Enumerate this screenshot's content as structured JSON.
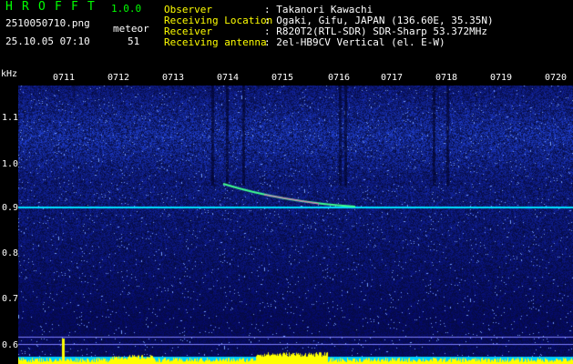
{
  "app": {
    "title_letters": [
      "H",
      "R",
      "O",
      "F",
      "F",
      "T"
    ],
    "version": "1.0.0"
  },
  "file": {
    "name": "2510050710.png",
    "timestamp": "25.10.05 07:10"
  },
  "meteor": {
    "label": "meteor",
    "count": "51"
  },
  "info": {
    "observer_label": "Observer",
    "observer_value": ": Takanori Kawachi",
    "location_label": "Receiving Location",
    "location_value": ": Ogaki, Gifu, JAPAN (136.60E, 35.35N)",
    "receiver_label": "Receiver",
    "receiver_value": ": R820T2(RTL-SDR) SDR-Sharp 53.372MHz",
    "antenna_label": "Receiving antenna",
    "antenna_value": ": 2el-HB9CV Vertical (el. E-W)"
  },
  "axis": {
    "unit": "kHz",
    "y_ticks": [
      "1.1",
      "1.0",
      "0.9",
      "0.8",
      "0.7",
      "0.6"
    ],
    "time_ticks": [
      "0711",
      "0712",
      "0713",
      "0714",
      "0715",
      "0716",
      "0717",
      "0718",
      "0719",
      "0720"
    ]
  },
  "colors": {
    "background": "#000000",
    "title_green": "#00ff00",
    "signal_blue": "#1a2a9a",
    "trace_cyan": "#00e0ff"
  }
}
